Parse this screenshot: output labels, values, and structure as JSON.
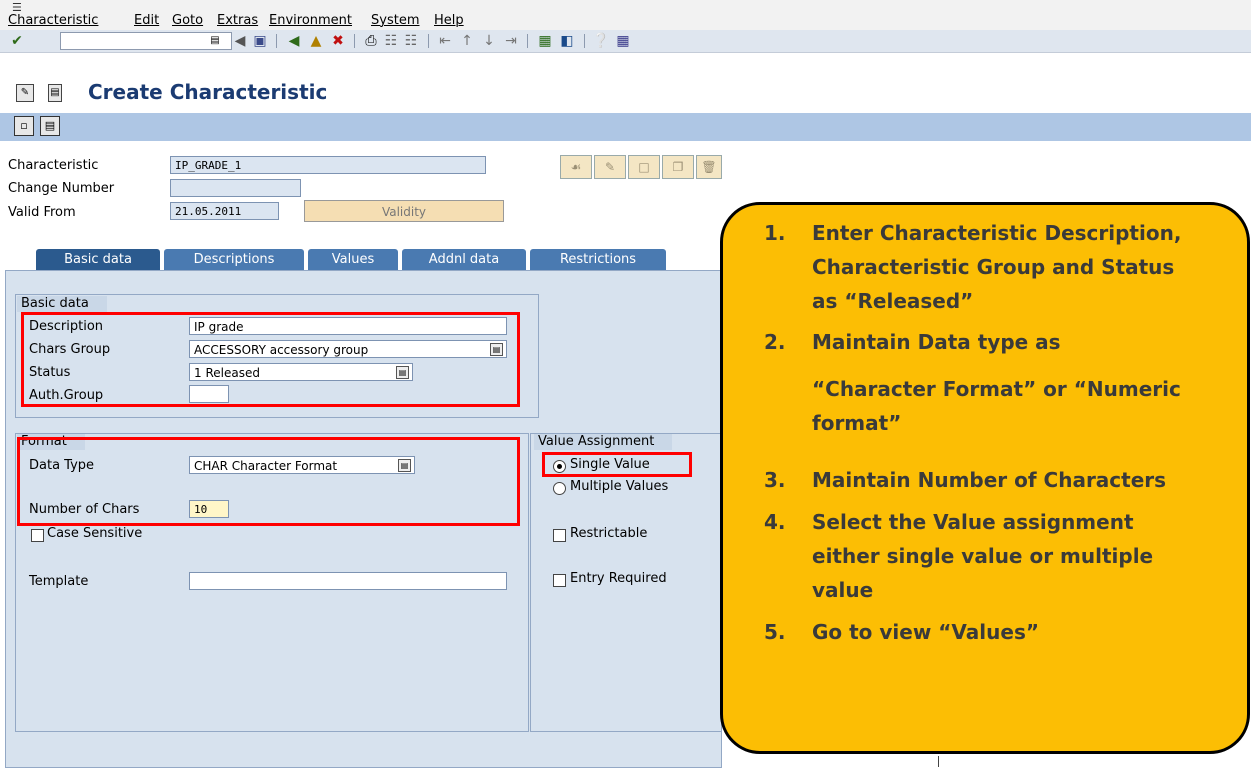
{
  "menu": {
    "items": [
      "Characteristic",
      "Edit",
      "Goto",
      "Extras",
      "Environment",
      "System",
      "Help"
    ]
  },
  "toolbar": {
    "okcode_value": "",
    "icons": [
      "check-icon",
      "back-icon",
      "save-icon",
      "exit-icon",
      "cancel-icon",
      "print-icon",
      "find-icon",
      "find-next-icon",
      "first-page-icon",
      "prev-page-icon",
      "next-page-icon",
      "last-page-icon",
      "new-session-icon",
      "shortcut-icon",
      "help-icon",
      "layout-icon"
    ]
  },
  "title": "Create Characteristic",
  "header": {
    "characteristic_label": "Characteristic",
    "characteristic_value": "IP_GRADE_1",
    "change_number_label": "Change Number",
    "change_number_value": "",
    "valid_from_label": "Valid From",
    "valid_from_value": "21.05.2011",
    "validity_button": "Validity"
  },
  "tabs": [
    {
      "label": "Basic data",
      "active": true
    },
    {
      "label": "Descriptions",
      "active": false
    },
    {
      "label": "Values",
      "active": false
    },
    {
      "label": "Addnl data",
      "active": false
    },
    {
      "label": "Restrictions",
      "active": false
    }
  ],
  "basic_data_group": {
    "title": "Basic data",
    "description_label": "Description",
    "description_value": "IP grade",
    "chars_group_label": "Chars Group",
    "chars_group_value": "ACCESSORY accessory group",
    "status_label": "Status",
    "status_value": "1 Released",
    "auth_group_label": "Auth.Group",
    "auth_group_value": ""
  },
  "format_group": {
    "title": "Format",
    "data_type_label": "Data Type",
    "data_type_value": "CHAR Character Format",
    "number_of_chars_label": "Number of Chars",
    "number_of_chars_value": "10",
    "case_sensitive_label": "Case Sensitive",
    "template_label": "Template",
    "template_value": ""
  },
  "value_assignment_group": {
    "title": "Value Assignment",
    "single_value_label": "Single Value",
    "multiple_values_label": "Multiple Values",
    "restrictable_label": "Restrictable",
    "entry_required_label": "Entry Required"
  },
  "callout": {
    "steps": [
      {
        "num": "1.",
        "lines": [
          "Enter Characteristic Description,",
          "Characteristic Group and Status",
          "as “Released”"
        ]
      },
      {
        "num": "2.",
        "lines": [
          "Maintain Data type as",
          "“Character Format” or “Numeric",
          "format”"
        ]
      },
      {
        "num": "3.",
        "lines": [
          "Maintain Number of Characters"
        ]
      },
      {
        "num": "4.",
        "lines": [
          "Select the Value assignment",
          "either single value or multiple",
          "value"
        ]
      },
      {
        "num": "5.",
        "lines": [
          "Go to view “Values”"
        ]
      }
    ]
  },
  "colors": {
    "callout_bg": "#fcbe04",
    "title_text": "#1b3b72",
    "highlight_red": "#ff0000",
    "tab_active": "#2b5a8e"
  }
}
